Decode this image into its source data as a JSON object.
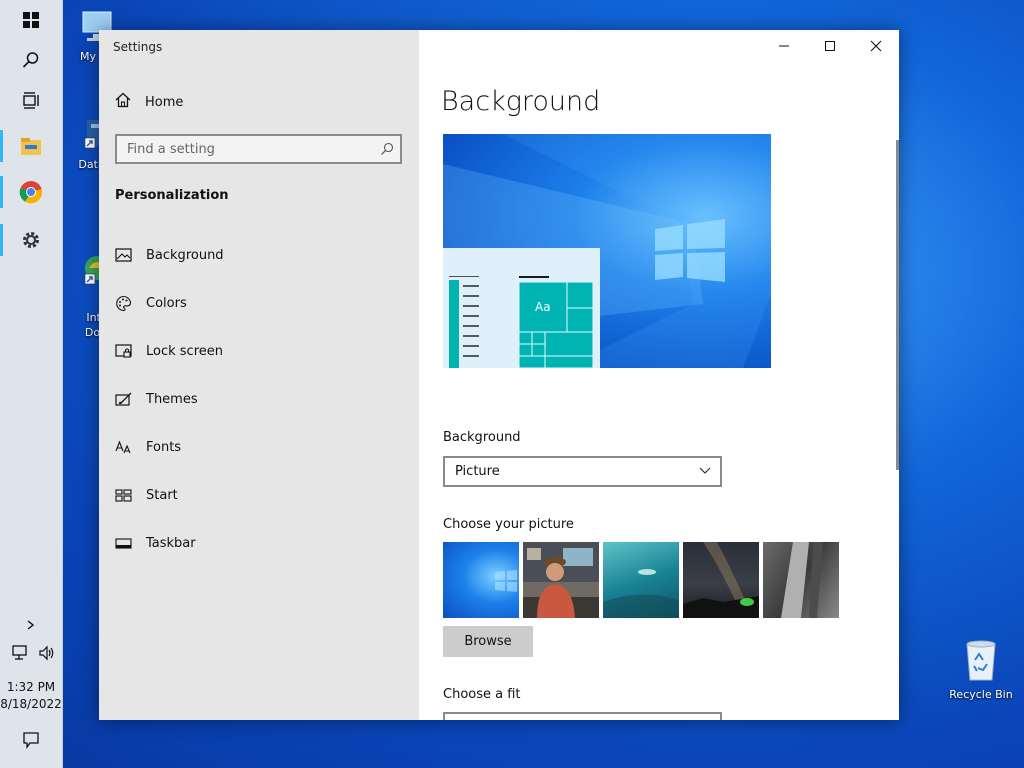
{
  "taskbar": {
    "clock_time": "1:32 PM",
    "clock_date": "8/18/2022",
    "icons": [
      "windows-start-icon",
      "search-icon",
      "task-view-icon",
      "file-explorer-icon",
      "chrome-icon",
      "settings-gear-icon",
      "chevron-up-icon",
      "network-icon",
      "volume-icon",
      "notification-icon"
    ]
  },
  "desktop": {
    "icons": [
      {
        "label": "My Co"
      },
      {
        "label": "DataW"
      },
      {
        "label": "Inte\nDow"
      },
      {
        "label": "Recycle Bin"
      }
    ]
  },
  "window": {
    "title": "Settings",
    "nav": {
      "home_label": "Home",
      "search_placeholder": "Find a setting",
      "section_title": "Personalization",
      "items": [
        {
          "label": "Background",
          "icon": "picture-icon"
        },
        {
          "label": "Colors",
          "icon": "palette-icon"
        },
        {
          "label": "Lock screen",
          "icon": "lock-screen-icon"
        },
        {
          "label": "Themes",
          "icon": "themes-brush-icon"
        },
        {
          "label": "Fonts",
          "icon": "fonts-icon"
        },
        {
          "label": "Start",
          "icon": "start-menu-icon"
        },
        {
          "label": "Taskbar",
          "icon": "taskbar-icon"
        }
      ]
    },
    "content": {
      "page_title": "Background",
      "preview_tile_text": "Aa",
      "background_label": "Background",
      "background_value": "Picture",
      "choose_picture_label": "Choose your picture",
      "browse_label": "Browse",
      "choose_fit_label": "Choose a fit"
    }
  },
  "colors": {
    "accent_teal": "#00b4b4",
    "desktop_blue": "#0a45b8",
    "nav_bg": "#e6e6e6"
  }
}
